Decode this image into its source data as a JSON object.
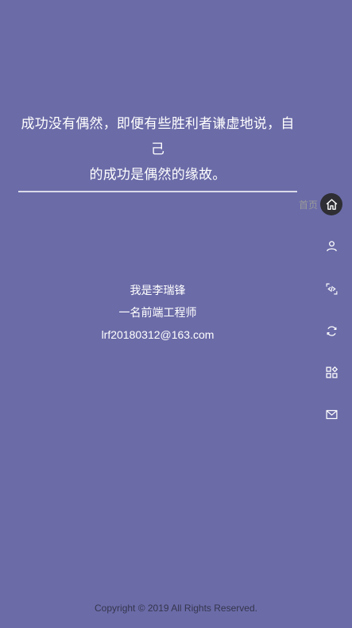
{
  "quote": {
    "line1": "成功没有偶然，即便有些胜利者谦虚地说，自己",
    "line2": "的成功是偶然的缘故。"
  },
  "intro": {
    "name": "我是李瑞锋",
    "role": "一名前端工程师",
    "email": "lrf20180312@163.com"
  },
  "nav": {
    "home_label": "首页",
    "items": [
      {
        "icon": "home-icon"
      },
      {
        "icon": "user-icon"
      },
      {
        "icon": "code-icon"
      },
      {
        "icon": "refresh-icon"
      },
      {
        "icon": "apps-icon"
      },
      {
        "icon": "mail-icon"
      }
    ]
  },
  "footer": {
    "copyright": "Copyright © 2019 All Rights Reserved."
  },
  "colors": {
    "background": "#6b6ba8",
    "active_nav_bg": "#2e2e34",
    "footer_text": "#36364e"
  }
}
